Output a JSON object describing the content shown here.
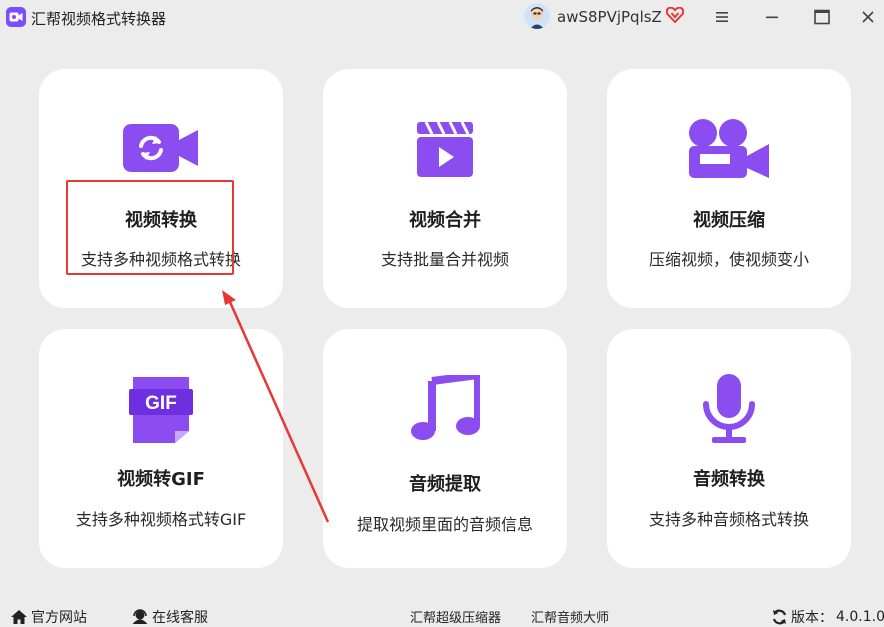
{
  "app": {
    "title": "汇帮视频格式转换器",
    "username": "awS8PVjPqlsZ",
    "accent": "#8b4cf0"
  },
  "window_controls": {
    "menu_icon": "hamburger-icon",
    "minimize_icon": "minimize-icon",
    "maximize_icon": "maximize-icon",
    "close_icon": "close-icon"
  },
  "cards": [
    {
      "title": "视频转换",
      "desc": "支持多种视频格式转换",
      "icon": "video-convert-icon"
    },
    {
      "title": "视频合并",
      "desc": "支持批量合并视频",
      "icon": "clapperboard-icon"
    },
    {
      "title": "视频压缩",
      "desc": "压缩视频，使视频变小",
      "icon": "video-camera-icon"
    },
    {
      "title": "视频转GIF",
      "desc": "支持多种视频格式转GIF",
      "icon": "gif-file-icon"
    },
    {
      "title": "音频提取",
      "desc": "提取视频里面的音频信息",
      "icon": "music-note-icon"
    },
    {
      "title": "音频转换",
      "desc": "支持多种音频格式转换",
      "icon": "microphone-icon"
    }
  ],
  "statusbar": {
    "website": "官方网站",
    "support": "在线客服",
    "link1": "汇帮超级压缩器",
    "link2": "汇帮音频大师",
    "version_label": "版本：",
    "version": "4.0.1.0"
  }
}
